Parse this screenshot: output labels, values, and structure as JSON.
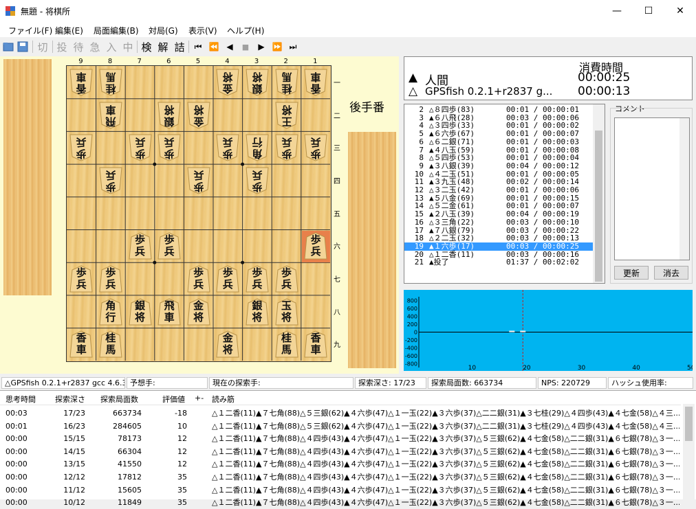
{
  "window": {
    "title": "無題 - 将棋所",
    "minimize": "—",
    "maximize": "☐",
    "close": "✕"
  },
  "menu": [
    "ファイル(F)",
    "編集(E)",
    "局面編集(B)",
    "対局(G)",
    "表示(V)",
    "ヘルプ(H)"
  ],
  "toolbar": {
    "text_buttons": [
      "切",
      "投",
      "待",
      "急",
      "入",
      "中",
      "検",
      "解",
      "詰"
    ],
    "nav_buttons": [
      "⏮",
      "⏪",
      "◀",
      "■",
      "▶",
      "⏩",
      "⏭"
    ]
  },
  "board": {
    "files": [
      "9",
      "8",
      "7",
      "6",
      "5",
      "4",
      "3",
      "2",
      "1"
    ],
    "ranks": [
      "一",
      "二",
      "三",
      "四",
      "五",
      "六",
      "七",
      "八",
      "九"
    ],
    "turn_label": "後手番",
    "gote_pieces": [
      {
        "f": 9,
        "r": 1,
        "t": [
          "香",
          "車"
        ]
      },
      {
        "f": 8,
        "r": 1,
        "t": [
          "桂",
          "馬"
        ]
      },
      {
        "f": 4,
        "r": 1,
        "t": [
          "金",
          "将"
        ]
      },
      {
        "f": 3,
        "r": 1,
        "t": [
          "銀",
          "将"
        ]
      },
      {
        "f": 2,
        "r": 1,
        "t": [
          "桂",
          "馬"
        ]
      },
      {
        "f": 1,
        "r": 1,
        "t": [
          "香",
          "車"
        ]
      },
      {
        "f": 8,
        "r": 2,
        "t": [
          "飛",
          "車"
        ]
      },
      {
        "f": 6,
        "r": 2,
        "t": [
          "銀",
          "将"
        ]
      },
      {
        "f": 5,
        "r": 2,
        "t": [
          "金",
          "将"
        ]
      },
      {
        "f": 2,
        "r": 2,
        "t": [
          "王",
          "将"
        ]
      },
      {
        "f": 9,
        "r": 3,
        "t": [
          "歩",
          "兵"
        ]
      },
      {
        "f": 7,
        "r": 3,
        "t": [
          "歩",
          "兵"
        ]
      },
      {
        "f": 6,
        "r": 3,
        "t": [
          "歩",
          "兵"
        ]
      },
      {
        "f": 4,
        "r": 3,
        "t": [
          "歩",
          "兵"
        ]
      },
      {
        "f": 3,
        "r": 3,
        "t": [
          "角",
          "行"
        ]
      },
      {
        "f": 2,
        "r": 3,
        "t": [
          "歩",
          "兵"
        ]
      },
      {
        "f": 1,
        "r": 3,
        "t": [
          "歩",
          "兵"
        ]
      },
      {
        "f": 8,
        "r": 4,
        "t": [
          "歩",
          "兵"
        ]
      },
      {
        "f": 5,
        "r": 4,
        "t": [
          "歩",
          "兵"
        ]
      },
      {
        "f": 3,
        "r": 4,
        "t": [
          "歩",
          "兵"
        ]
      }
    ],
    "sente_pieces": [
      {
        "f": 7,
        "r": 6,
        "t": [
          "歩",
          "兵"
        ]
      },
      {
        "f": 6,
        "r": 6,
        "t": [
          "歩",
          "兵"
        ]
      },
      {
        "f": 1,
        "r": 6,
        "t": [
          "歩",
          "兵"
        ],
        "last": true
      },
      {
        "f": 9,
        "r": 7,
        "t": [
          "歩",
          "兵"
        ]
      },
      {
        "f": 8,
        "r": 7,
        "t": [
          "歩",
          "兵"
        ]
      },
      {
        "f": 5,
        "r": 7,
        "t": [
          "歩",
          "兵"
        ]
      },
      {
        "f": 4,
        "r": 7,
        "t": [
          "歩",
          "兵"
        ]
      },
      {
        "f": 3,
        "r": 7,
        "t": [
          "歩",
          "兵"
        ]
      },
      {
        "f": 2,
        "r": 7,
        "t": [
          "歩",
          "兵"
        ]
      },
      {
        "f": 8,
        "r": 8,
        "t": [
          "角",
          "行"
        ]
      },
      {
        "f": 7,
        "r": 8,
        "t": [
          "銀",
          "将"
        ]
      },
      {
        "f": 6,
        "r": 8,
        "t": [
          "飛",
          "車"
        ]
      },
      {
        "f": 5,
        "r": 8,
        "t": [
          "金",
          "将"
        ]
      },
      {
        "f": 3,
        "r": 8,
        "t": [
          "銀",
          "将"
        ]
      },
      {
        "f": 2,
        "r": 8,
        "t": [
          "玉",
          "将"
        ]
      },
      {
        "f": 9,
        "r": 9,
        "t": [
          "香",
          "車"
        ]
      },
      {
        "f": 8,
        "r": 9,
        "t": [
          "桂",
          "馬"
        ]
      },
      {
        "f": 4,
        "r": 9,
        "t": [
          "金",
          "将"
        ]
      },
      {
        "f": 2,
        "r": 9,
        "t": [
          "桂",
          "馬"
        ]
      },
      {
        "f": 1,
        "r": 9,
        "t": [
          "香",
          "車"
        ]
      }
    ]
  },
  "clock": {
    "header": "消費時間",
    "sente_mark": "▲",
    "sente_name": "人間",
    "sente_time": "00:00:25",
    "gote_mark": "△",
    "gote_name": "GPSfish 0.2.1+r2837 g...",
    "gote_time": "00:00:13"
  },
  "kifu": [
    {
      "n": "2",
      "mv": "△８四歩(83)",
      "t": "00:01 / 00:00:01"
    },
    {
      "n": "3",
      "mv": "▲６八飛(28)",
      "t": "00:03 / 00:00:06"
    },
    {
      "n": "4",
      "mv": "△３四歩(33)",
      "t": "00:01 / 00:00:02"
    },
    {
      "n": "5",
      "mv": "▲６六歩(67)",
      "t": "00:01 / 00:00:07"
    },
    {
      "n": "6",
      "mv": "△６二銀(71)",
      "t": "00:01 / 00:00:03"
    },
    {
      "n": "7",
      "mv": "▲４八玉(59)",
      "t": "00:01 / 00:00:08"
    },
    {
      "n": "8",
      "mv": "△５四歩(53)",
      "t": "00:01 / 00:00:04"
    },
    {
      "n": "9",
      "mv": "▲３八銀(39)",
      "t": "00:04 / 00:00:12"
    },
    {
      "n": "10",
      "mv": "△４二玉(51)",
      "t": "00:01 / 00:00:05"
    },
    {
      "n": "11",
      "mv": "▲３九玉(48)",
      "t": "00:02 / 00:00:14"
    },
    {
      "n": "12",
      "mv": "△３二玉(42)",
      "t": "00:01 / 00:00:06"
    },
    {
      "n": "13",
      "mv": "▲５八金(69)",
      "t": "00:01 / 00:00:15"
    },
    {
      "n": "14",
      "mv": "△５二金(61)",
      "t": "00:01 / 00:00:07"
    },
    {
      "n": "15",
      "mv": "▲２八玉(39)",
      "t": "00:04 / 00:00:19"
    },
    {
      "n": "16",
      "mv": "△３三角(22)",
      "t": "00:03 / 00:00:10"
    },
    {
      "n": "17",
      "mv": "▲７八銀(79)",
      "t": "00:03 / 00:00:22"
    },
    {
      "n": "18",
      "mv": "△２二玉(32)",
      "t": "00:03 / 00:00:13"
    },
    {
      "n": "19",
      "mv": "▲１六歩(17)",
      "t": "00:03 / 00:00:25",
      "sel": true
    },
    {
      "n": "20",
      "mv": "△１二香(11)",
      "t": "00:03 / 00:00:16"
    },
    {
      "n": "21",
      "mv": "▲投了",
      "t": "01:37 / 00:02:02"
    }
  ],
  "comment": {
    "label": "コメント",
    "update_button": "更新",
    "clear_button": "消去"
  },
  "graph": {
    "y_ticks": [
      "800",
      "600",
      "400",
      "200",
      "0",
      "-200",
      "-400",
      "-600",
      "-800"
    ],
    "x_ticks": [
      "10",
      "20",
      "30",
      "40",
      "50"
    ],
    "color": "#00b4f0"
  },
  "status": [
    "△GPSfish 0.2.1+r2837 gcc 4.6.3 ...",
    "予想手:",
    "現在の探索手:",
    "探索深さ: 17/23",
    "探索局面数: 663734",
    "NPS: 220729",
    "ハッシュ使用率:"
  ],
  "think": {
    "headers": [
      "思考時間",
      "探索深さ",
      "探索局面数",
      "評価値",
      "+-",
      "読み筋"
    ],
    "rows": [
      {
        "time": "00:03",
        "depth": "17/23",
        "nodes": "663734",
        "eval": "-18",
        "pv": "△１二香(11)▲７七角(88)△５三銀(62)▲４六歩(47)△１一玉(22)▲３六歩(37)△二二銀(31)▲３七桂(29)△４四歩(43)▲４七金(58)△４三..."
      },
      {
        "time": "00:01",
        "depth": "16/23",
        "nodes": "284605",
        "eval": "10",
        "pv": "△１二香(11)▲７七角(88)△５三銀(62)▲４六歩(47)△１一玉(22)▲３六歩(37)△二二銀(31)▲３七桂(29)△４四歩(43)▲４七金(58)△４三..."
      },
      {
        "time": "00:00",
        "depth": "15/15",
        "nodes": "78173",
        "eval": "12",
        "pv": "△１二香(11)▲７七角(88)△４四歩(43)▲４六歩(47)△１一玉(22)▲３六歩(37)△５三銀(62)▲４七金(58)△二二銀(31)▲６七銀(78)△３一..."
      },
      {
        "time": "00:00",
        "depth": "14/15",
        "nodes": "66304",
        "eval": "12",
        "pv": "△１二香(11)▲７七角(88)△４四歩(43)▲４六歩(47)△１一玉(22)▲３六歩(37)△５三銀(62)▲４七金(58)△二二銀(31)▲６七銀(78)△３一..."
      },
      {
        "time": "00:00",
        "depth": "13/15",
        "nodes": "41550",
        "eval": "12",
        "pv": "△１二香(11)▲７七角(88)△４四歩(43)▲４六歩(47)△１一玉(22)▲３六歩(37)△５三銀(62)▲４七金(58)△二二銀(31)▲６七銀(78)△３一..."
      },
      {
        "time": "00:00",
        "depth": "12/12",
        "nodes": "17812",
        "eval": "35",
        "pv": "△１二香(11)▲７七角(88)△４四歩(43)▲４六歩(47)△１一玉(22)▲３六歩(37)△５三銀(62)▲４七金(58)△二二銀(31)▲６七銀(78)△３一..."
      },
      {
        "time": "00:00",
        "depth": "11/12",
        "nodes": "15605",
        "eval": "35",
        "pv": "△１二香(11)▲７七角(88)△４四歩(43)▲４六歩(47)△１一玉(22)▲３六歩(37)△５三銀(62)▲４七金(58)△二二銀(31)▲６七銀(78)△３一..."
      },
      {
        "time": "00:00",
        "depth": "10/12",
        "nodes": "11849",
        "eval": "35",
        "pv": "△１二香(11)▲７七角(88)△４四歩(43)▲４六歩(47)△１一玉(22)▲３六歩(37)△５三銀(62)▲４七金(58)△二二銀(31)▲６七銀(78)△３一..."
      }
    ]
  }
}
